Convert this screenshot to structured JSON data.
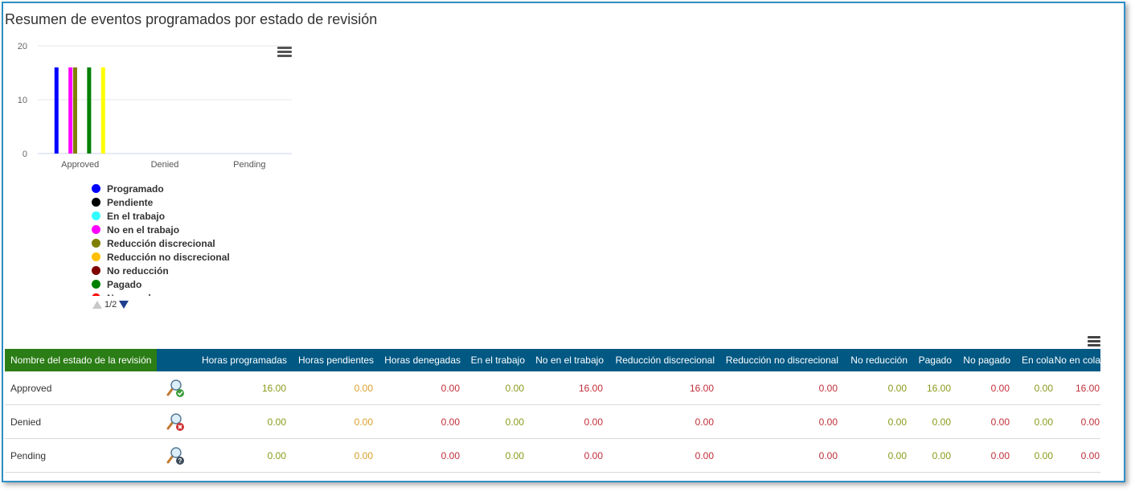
{
  "page": {
    "title": "Resumen de eventos programados por estado de revisión"
  },
  "chart_data": {
    "type": "bar",
    "title": "",
    "xlabel": "",
    "ylabel": "",
    "ylim": [
      0,
      20
    ],
    "yticks": [
      "0",
      "10",
      "20"
    ],
    "categories": [
      "Approved",
      "Denied",
      "Pending"
    ],
    "grid": true,
    "legend_placement": "bottom-left",
    "series": [
      {
        "name": "Programado",
        "color": "#0000ff",
        "values": [
          16,
          0,
          0
        ]
      },
      {
        "name": "Pendiente",
        "color": "#000000",
        "values": [
          0,
          0,
          0
        ]
      },
      {
        "name": "En el trabajo",
        "color": "#33ffff",
        "values": [
          0,
          0,
          0
        ]
      },
      {
        "name": "No en el trabajo",
        "color": "#ff00ff",
        "values": [
          16,
          0,
          0
        ]
      },
      {
        "name": "Reducción discrecional",
        "color": "#808000",
        "values": [
          16,
          0,
          0
        ]
      },
      {
        "name": "Reducción no discrecional",
        "color": "#ffc000",
        "values": [
          0,
          0,
          0
        ]
      },
      {
        "name": "No reducción",
        "color": "#800000",
        "values": [
          0,
          0,
          0
        ]
      },
      {
        "name": "Pagado",
        "color": "#008000",
        "values": [
          16,
          0,
          0
        ]
      },
      {
        "name": "No pagado",
        "color": "#ff0000",
        "values": [
          0,
          0,
          0
        ]
      },
      {
        "name": "En cola",
        "color": "#c0c0c0",
        "values": [
          0,
          0,
          0
        ]
      },
      {
        "name": "No en cola",
        "color": "#ffff00",
        "values": [
          16,
          0,
          0
        ]
      }
    ]
  },
  "legend": {
    "items": [
      "Programado",
      "Pendiente",
      "En el trabajo",
      "No en el trabajo",
      "Reducción discrecional",
      "Reducción no discrecional",
      "No reducción",
      "Pagado",
      "No pagado"
    ],
    "colors": [
      "#0000ff",
      "#000000",
      "#33ffff",
      "#ff00ff",
      "#808000",
      "#ffc000",
      "#800000",
      "#008000",
      "#ff0000"
    ],
    "page_indicator": "1/2"
  },
  "table": {
    "headers": [
      "Nombre del estado de la revisión",
      "",
      "Horas programadas",
      "Horas pendientes",
      "Horas denegadas",
      "En el trabajo",
      "No en el trabajo",
      "Reducción discrecional",
      "Reducción no discrecional",
      "No reducción",
      "Pagado",
      "No pagado",
      "En cola",
      "No en cola"
    ],
    "rows": [
      {
        "name": "Approved",
        "icon": "magnifier-check-icon",
        "values": [
          "16.00",
          "0.00",
          "0.00",
          "0.00",
          "16.00",
          "16.00",
          "0.00",
          "0.00",
          "16.00",
          "0.00",
          "0.00",
          "16.00"
        ]
      },
      {
        "name": "Denied",
        "icon": "magnifier-x-icon",
        "values": [
          "0.00",
          "0.00",
          "0.00",
          "0.00",
          "0.00",
          "0.00",
          "0.00",
          "0.00",
          "0.00",
          "0.00",
          "0.00",
          "0.00"
        ]
      },
      {
        "name": "Pending",
        "icon": "magnifier-question-icon",
        "values": [
          "0.00",
          "0.00",
          "0.00",
          "0.00",
          "0.00",
          "0.00",
          "0.00",
          "0.00",
          "0.00",
          "0.00",
          "0.00",
          "0.00"
        ]
      }
    ],
    "column_colors": [
      "#8a9a1a",
      "#d8a02a",
      "#c0303a",
      "#8a9a1a",
      "#c0303a",
      "#c0303a",
      "#c0303a",
      "#8a9a1a",
      "#8a9a1a",
      "#c0303a",
      "#8a9a1a",
      "#c0303a"
    ]
  }
}
